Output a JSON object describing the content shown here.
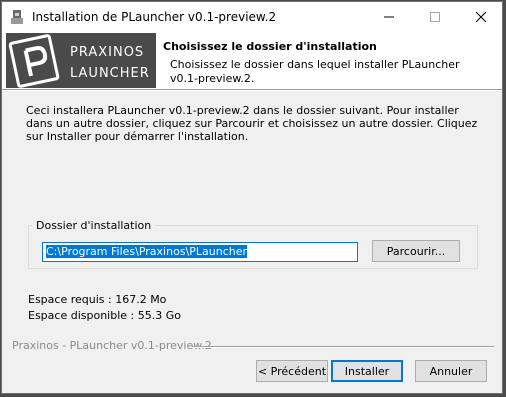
{
  "window": {
    "title": "Installation de PLauncher v0.1-preview.2"
  },
  "header": {
    "logo_top": "PRAXINOS",
    "logo_bottom": "LAUNCHER",
    "title": "Choisissez le dossier d'installation",
    "subtitle_line1": "Choisissez le dossier dans lequel installer PLauncher",
    "subtitle_line2": "v0.1-preview.2."
  },
  "body": {
    "intro": "Ceci installera PLauncher v0.1-preview.2 dans le dossier suivant. Pour installer dans un autre dossier, cliquez sur Parcourir et choisissez un autre dossier. Cliquez sur Installer pour démarrer l'installation.",
    "group_label": "Dossier d'installation",
    "install_path": "C:\\Program Files\\Praxinos\\PLauncher",
    "browse_label": "Parcourir...",
    "space_required": "Espace requis : 167.2 Mo",
    "space_available": "Espace disponible : 55.3 Go"
  },
  "footer": {
    "brand": "Praxinos - PLauncher v0.1-preview.2",
    "back_label": "< Précédent",
    "install_label": "Installer",
    "cancel_label": "Annuler"
  },
  "colors": {
    "accent": "#0078d7",
    "logo_bg": "#4a4a4a"
  }
}
